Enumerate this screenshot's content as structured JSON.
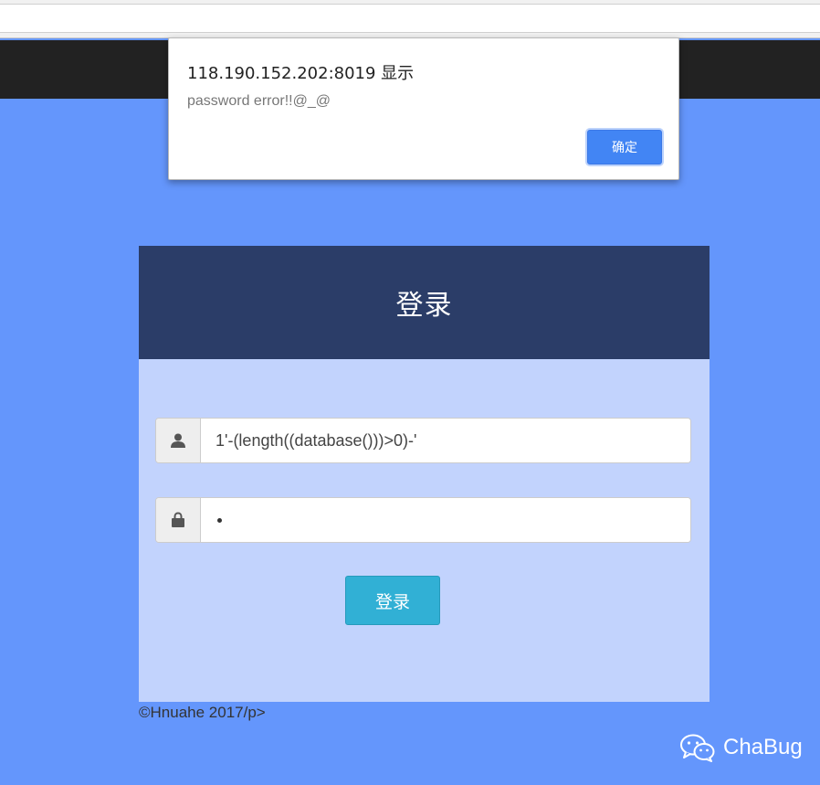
{
  "login": {
    "title": "登录",
    "username_value": "1'-(length((database()))>0)-'",
    "button_label": "登录"
  },
  "footer": {
    "text": "©Hnuahe 2017/p>"
  },
  "watermark": {
    "text": "ChaBug"
  },
  "alert": {
    "title": "118.190.152.202:8019 显示",
    "message": "password error!!@_@",
    "ok_label": "确定"
  },
  "icons": {
    "user": "user-icon",
    "password": "lock-icon",
    "watermark": "wechat-icon"
  },
  "colors": {
    "page_background": "#6496fc",
    "panel_header": "#2b3d68",
    "panel_body": "#c2d3fd",
    "login_button": "#31b0d5",
    "ok_button": "#4285f4",
    "navbar": "#222222"
  }
}
